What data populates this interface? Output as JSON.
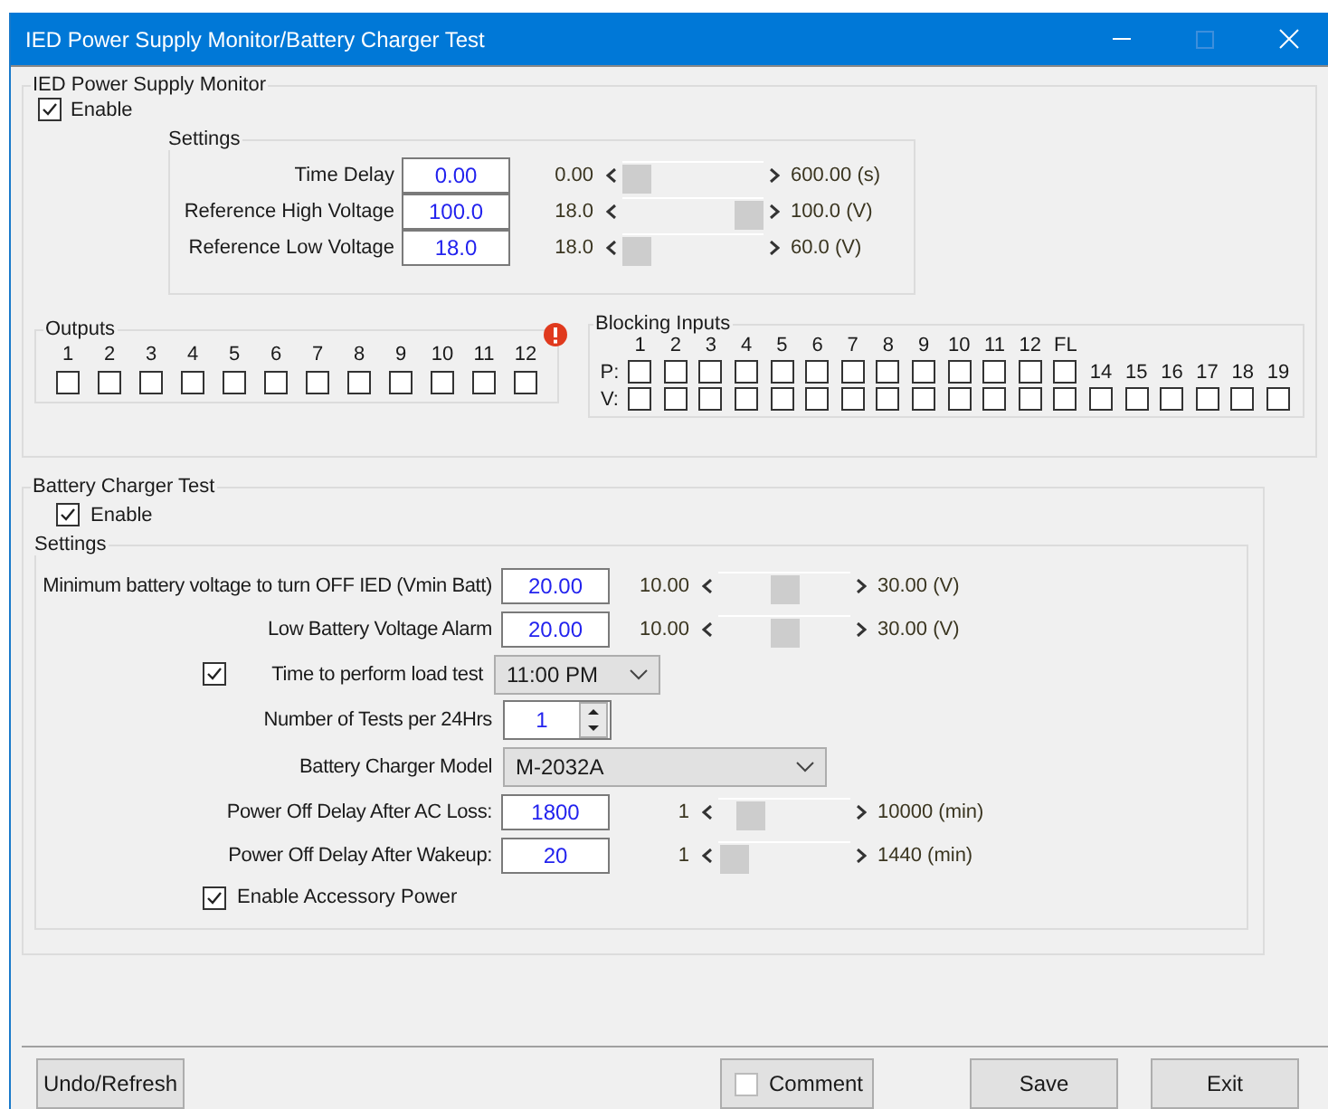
{
  "window": {
    "title": "IED Power Supply Monitor/Battery Charger Test"
  },
  "power_supply_monitor": {
    "title": "IED Power Supply Monitor",
    "enable": {
      "label": "Enable",
      "checked": true
    },
    "settings": {
      "title": "Settings",
      "rows": [
        {
          "label": "Time Delay",
          "value": "0.00",
          "min": "0.00",
          "max": "600.00",
          "unit": "(s)",
          "level": 0
        },
        {
          "label": "Reference High Voltage",
          "value": "100.0",
          "min": "18.0",
          "max": "100.0",
          "unit": "(V)",
          "level": 1
        },
        {
          "label": "Reference Low Voltage",
          "value": "18.0",
          "min": "18.0",
          "max": "60.0",
          "unit": "(V)",
          "level": 0
        }
      ]
    },
    "outputs": {
      "title": "Outputs",
      "items": [
        {
          "label": "1",
          "checked": false
        },
        {
          "label": "2",
          "checked": false
        },
        {
          "label": "3",
          "checked": false
        },
        {
          "label": "4",
          "checked": false
        },
        {
          "label": "5",
          "checked": false
        },
        {
          "label": "6",
          "checked": false
        },
        {
          "label": "7",
          "checked": false
        },
        {
          "label": "8",
          "checked": false
        },
        {
          "label": "9",
          "checked": false
        },
        {
          "label": "10",
          "checked": false
        },
        {
          "label": "11",
          "checked": false
        },
        {
          "label": "12",
          "checked": false
        }
      ]
    },
    "blocking_inputs": {
      "title": "Blocking Inputs",
      "row_labels": [
        "P:",
        "V:"
      ],
      "columns": [
        {
          "label": "1",
          "p_checked": false,
          "v_checked": false
        },
        {
          "label": "2",
          "p_checked": false,
          "v_checked": false
        },
        {
          "label": "3",
          "p_checked": false,
          "v_checked": false
        },
        {
          "label": "4",
          "p_checked": false,
          "v_checked": false
        },
        {
          "label": "5",
          "p_checked": false,
          "v_checked": false
        },
        {
          "label": "6",
          "p_checked": false,
          "v_checked": false
        },
        {
          "label": "7",
          "p_checked": false,
          "v_checked": false
        },
        {
          "label": "8",
          "p_checked": false,
          "v_checked": false
        },
        {
          "label": "9",
          "p_checked": false,
          "v_checked": false
        },
        {
          "label": "10",
          "p_checked": false,
          "v_checked": false
        },
        {
          "label": "11",
          "p_checked": false,
          "v_checked": false
        },
        {
          "label": "12",
          "p_checked": false,
          "v_checked": false
        },
        {
          "label": "FL",
          "p_checked": false,
          "v_checked": false
        }
      ],
      "v_only": [
        {
          "label": "14",
          "v_checked": false
        },
        {
          "label": "15",
          "v_checked": false
        },
        {
          "label": "16",
          "v_checked": false
        },
        {
          "label": "17",
          "v_checked": false
        },
        {
          "label": "18",
          "v_checked": false
        },
        {
          "label": "19",
          "v_checked": false
        }
      ]
    }
  },
  "battery_charger_test": {
    "title": "Battery Charger Test",
    "enable": {
      "label": "Enable",
      "checked": true
    },
    "settings": {
      "title": "Settings",
      "rows": [
        {
          "kind": "slider",
          "label": "Minimum battery voltage to turn OFF IED (Vmin Batt)",
          "value": "20.00",
          "min": "10.00",
          "max": "30.00",
          "unit": "(V)",
          "level": 0.5
        },
        {
          "kind": "slider",
          "label": "Low Battery Voltage Alarm",
          "value": "20.00",
          "min": "10.00",
          "max": "30.00",
          "unit": "(V)",
          "level": 0.5
        },
        {
          "kind": "time",
          "label": "Time to perform load test",
          "checked": true,
          "value": "11:00 PM"
        },
        {
          "kind": "spinner",
          "label": "Number of Tests per 24Hrs",
          "value": "1"
        },
        {
          "kind": "dropdown",
          "label": "Battery Charger Model",
          "value": "M-2032A"
        },
        {
          "kind": "slider",
          "label": "Power Off Delay After AC Loss:",
          "value": "1800",
          "min": "1",
          "max": "10000",
          "unit": "(min)",
          "level": 0.17
        },
        {
          "kind": "slider",
          "label": "Power Off Delay After Wakeup:",
          "value": "20",
          "min": "1",
          "max": "1440",
          "unit": "(min)",
          "level": 0.01
        },
        {
          "kind": "checkbox",
          "label": "Enable Accessory Power",
          "checked": true
        }
      ]
    }
  },
  "footer": {
    "undo": "Undo/Refresh",
    "comment": {
      "label": "Comment",
      "checked": false
    },
    "save": "Save",
    "exit": "Exit"
  }
}
